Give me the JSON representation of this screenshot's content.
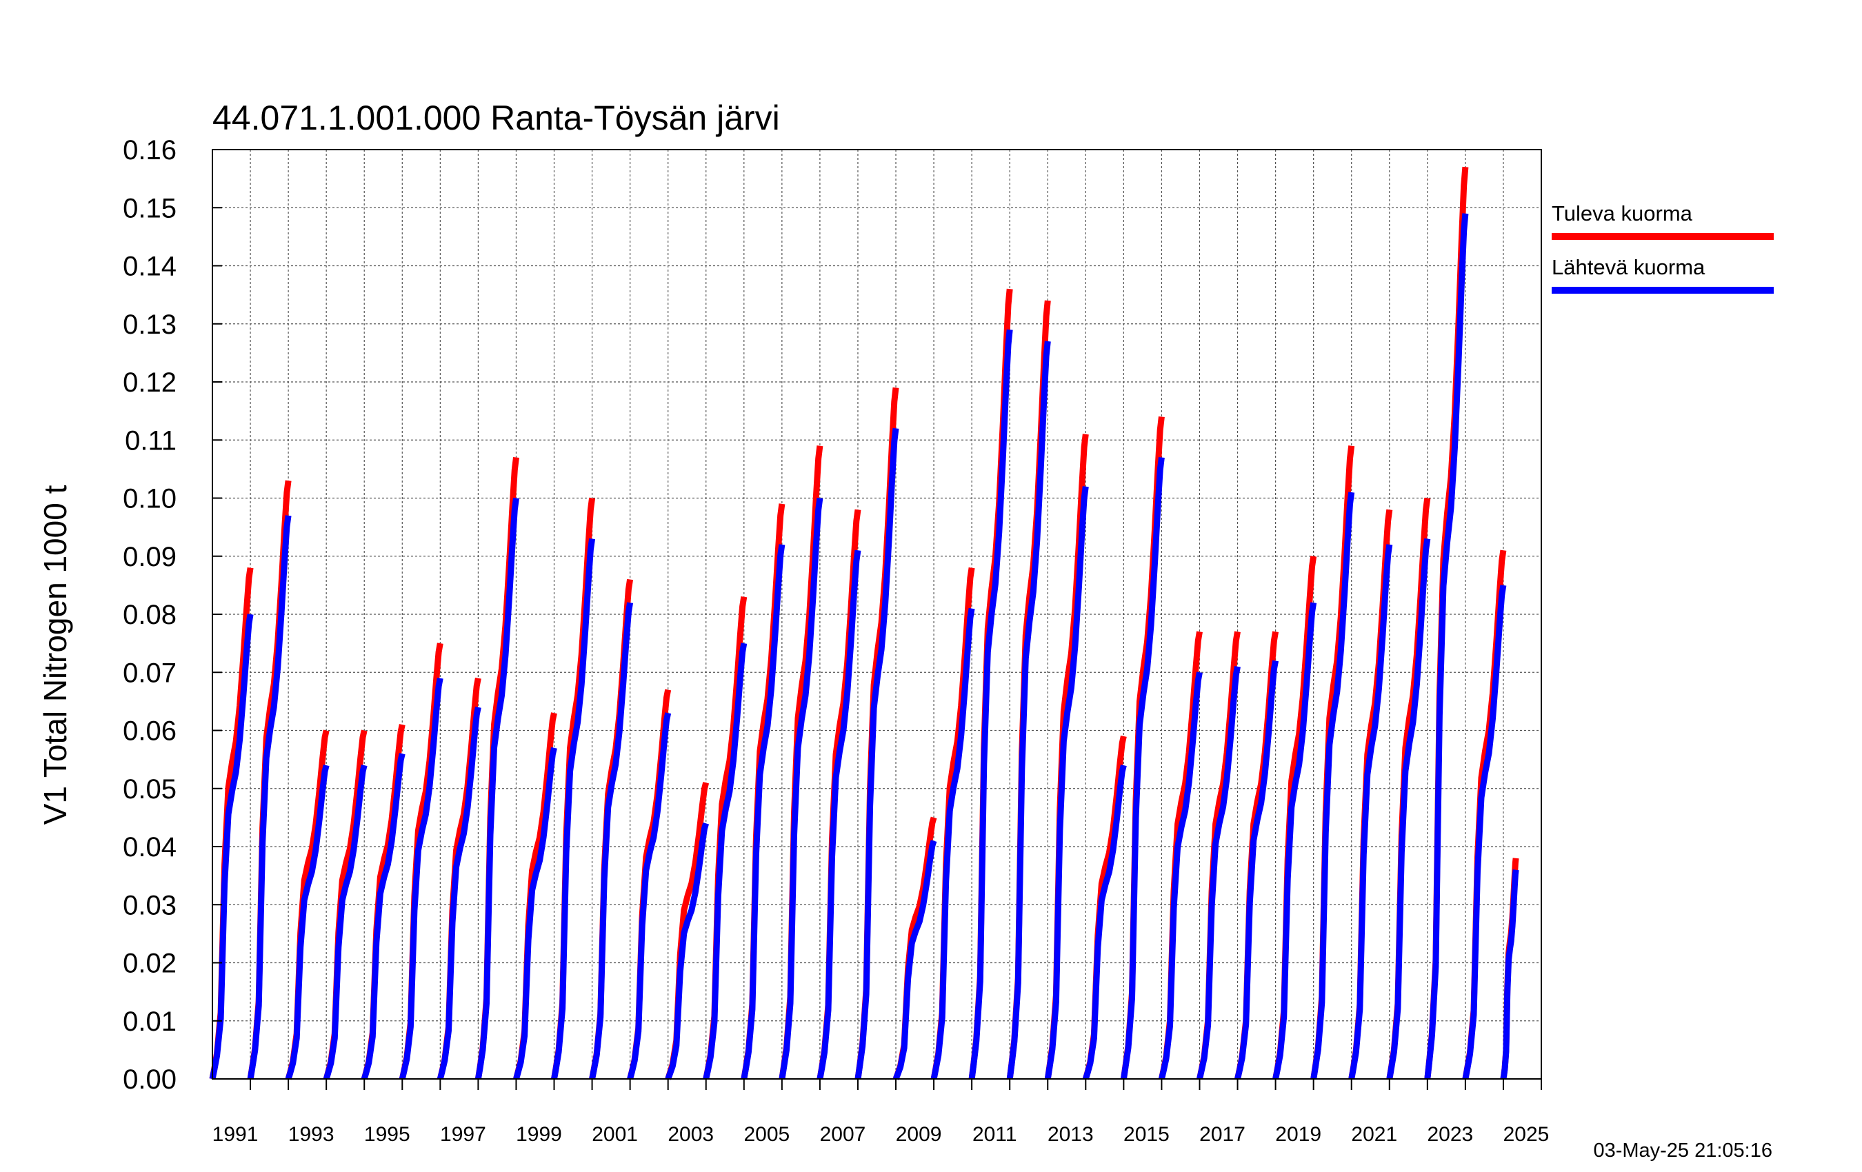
{
  "chart_data": {
    "type": "line",
    "title": "44.071.1.001.000 Ranta-Töysän järvi",
    "ylabel": "V1 Total Nitrogen 1000 t",
    "xlabel": "",
    "xlim": [
      1990,
      2025
    ],
    "ylim": [
      0,
      0.16
    ],
    "yticks": [
      "0.00",
      "0.01",
      "0.02",
      "0.03",
      "0.04",
      "0.05",
      "0.06",
      "0.07",
      "0.08",
      "0.09",
      "0.10",
      "0.11",
      "0.12",
      "0.13",
      "0.14",
      "0.15",
      "0.16"
    ],
    "xticks": [
      "1991",
      "1993",
      "1995",
      "1997",
      "1999",
      "2001",
      "2003",
      "2005",
      "2007",
      "2009",
      "2011",
      "2013",
      "2015",
      "2017",
      "2019",
      "2021",
      "2023",
      "2025"
    ],
    "grid": true,
    "legend_position": "right",
    "timestamp": "03-May-25 21:05:16",
    "series": [
      {
        "name": "Tuleva kuorma",
        "color": "#ff0000",
        "annual_totals": [
          0.088,
          0.103,
          0.06,
          0.06,
          0.061,
          0.075,
          0.069,
          0.107,
          0.063,
          0.1,
          0.086,
          0.067,
          0.051,
          0.083,
          0.099,
          0.109,
          0.098,
          0.119,
          0.045,
          0.088,
          0.136,
          0.134,
          0.111,
          0.059,
          0.114,
          0.077,
          0.077,
          0.077,
          0.09,
          0.109,
          0.098,
          0.1,
          0.157,
          0.091,
          0.038
        ]
      },
      {
        "name": "Lähtevä kuorma",
        "color": "#0000ff",
        "annual_totals": [
          0.08,
          0.097,
          0.054,
          0.054,
          0.056,
          0.069,
          0.064,
          0.1,
          0.057,
          0.093,
          0.082,
          0.063,
          0.044,
          0.075,
          0.092,
          0.1,
          0.091,
          0.112,
          0.041,
          0.081,
          0.129,
          0.127,
          0.102,
          0.054,
          0.107,
          0.07,
          0.071,
          0.072,
          0.082,
          0.101,
          0.092,
          0.093,
          0.149,
          0.085,
          0.036
        ]
      }
    ]
  }
}
